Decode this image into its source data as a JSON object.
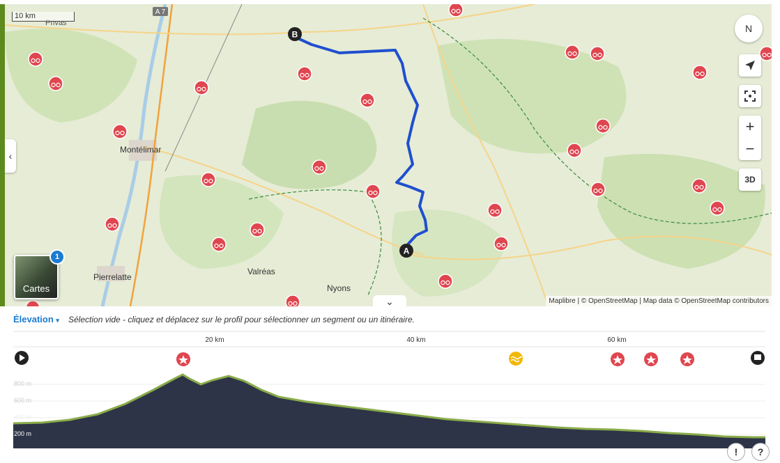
{
  "map": {
    "scale_label": "10 km",
    "highway_label": "A 7",
    "places": [
      {
        "name": "Privas"
      },
      {
        "name": "Montélimar"
      },
      {
        "name": "Pierrelatte"
      },
      {
        "name": "Valréas"
      },
      {
        "name": "Nyons"
      }
    ],
    "route_start_label": "A",
    "route_end_label": "B",
    "attribution": "Maplibre | © OpenStreetMap | Map data © OpenStreetMap contributors",
    "route_color": "#1f4fcf",
    "poi_color": "#e0464f",
    "layers_button": {
      "label": "Cartes",
      "badge": "1"
    },
    "controls": {
      "compass": "N",
      "zoom_in": "+",
      "zoom_out": "−",
      "three_d": "3D"
    }
  },
  "elevation": {
    "dropdown_label": "Élevation",
    "message": "Sélection vide - cliquez et déplacez sur le profil pour sélectionner un segment ou un itinéraire.",
    "x_ticks": [
      "20 km",
      "40 km",
      "60 km"
    ],
    "y_ticks": [
      "800 m",
      "600 m",
      "400 m",
      "200 m"
    ],
    "fill_color": "#2d3447",
    "line_color": "#8aac4a"
  },
  "footer": {
    "report_label": "!",
    "help_label": "?"
  }
}
